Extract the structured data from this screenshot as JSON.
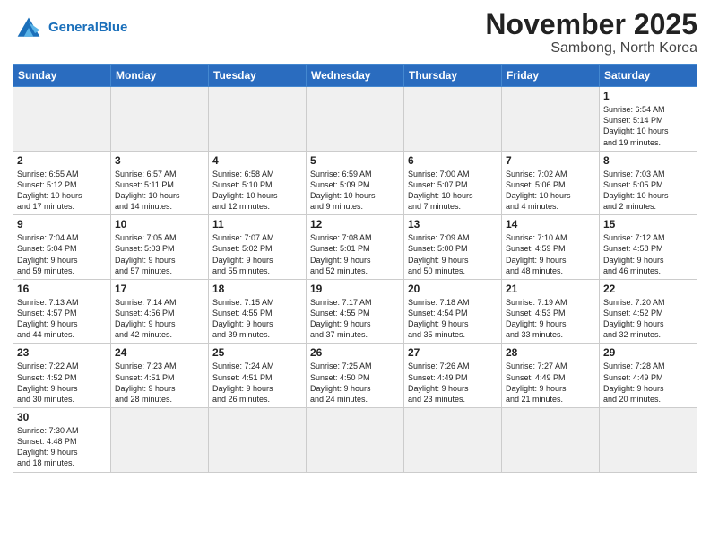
{
  "header": {
    "logo_general": "General",
    "logo_blue": "Blue",
    "title": "November 2025",
    "subtitle": "Sambong, North Korea"
  },
  "weekdays": [
    "Sunday",
    "Monday",
    "Tuesday",
    "Wednesday",
    "Thursday",
    "Friday",
    "Saturday"
  ],
  "days": [
    {
      "num": "",
      "info": "",
      "empty": true
    },
    {
      "num": "",
      "info": "",
      "empty": true
    },
    {
      "num": "",
      "info": "",
      "empty": true
    },
    {
      "num": "",
      "info": "",
      "empty": true
    },
    {
      "num": "",
      "info": "",
      "empty": true
    },
    {
      "num": "",
      "info": "",
      "empty": true
    },
    {
      "num": "1",
      "info": "Sunrise: 6:54 AM\nSunset: 5:14 PM\nDaylight: 10 hours\nand 19 minutes."
    },
    {
      "num": "2",
      "info": "Sunrise: 6:55 AM\nSunset: 5:12 PM\nDaylight: 10 hours\nand 17 minutes."
    },
    {
      "num": "3",
      "info": "Sunrise: 6:57 AM\nSunset: 5:11 PM\nDaylight: 10 hours\nand 14 minutes."
    },
    {
      "num": "4",
      "info": "Sunrise: 6:58 AM\nSunset: 5:10 PM\nDaylight: 10 hours\nand 12 minutes."
    },
    {
      "num": "5",
      "info": "Sunrise: 6:59 AM\nSunset: 5:09 PM\nDaylight: 10 hours\nand 9 minutes."
    },
    {
      "num": "6",
      "info": "Sunrise: 7:00 AM\nSunset: 5:07 PM\nDaylight: 10 hours\nand 7 minutes."
    },
    {
      "num": "7",
      "info": "Sunrise: 7:02 AM\nSunset: 5:06 PM\nDaylight: 10 hours\nand 4 minutes."
    },
    {
      "num": "8",
      "info": "Sunrise: 7:03 AM\nSunset: 5:05 PM\nDaylight: 10 hours\nand 2 minutes."
    },
    {
      "num": "9",
      "info": "Sunrise: 7:04 AM\nSunset: 5:04 PM\nDaylight: 9 hours\nand 59 minutes."
    },
    {
      "num": "10",
      "info": "Sunrise: 7:05 AM\nSunset: 5:03 PM\nDaylight: 9 hours\nand 57 minutes."
    },
    {
      "num": "11",
      "info": "Sunrise: 7:07 AM\nSunset: 5:02 PM\nDaylight: 9 hours\nand 55 minutes."
    },
    {
      "num": "12",
      "info": "Sunrise: 7:08 AM\nSunset: 5:01 PM\nDaylight: 9 hours\nand 52 minutes."
    },
    {
      "num": "13",
      "info": "Sunrise: 7:09 AM\nSunset: 5:00 PM\nDaylight: 9 hours\nand 50 minutes."
    },
    {
      "num": "14",
      "info": "Sunrise: 7:10 AM\nSunset: 4:59 PM\nDaylight: 9 hours\nand 48 minutes."
    },
    {
      "num": "15",
      "info": "Sunrise: 7:12 AM\nSunset: 4:58 PM\nDaylight: 9 hours\nand 46 minutes."
    },
    {
      "num": "16",
      "info": "Sunrise: 7:13 AM\nSunset: 4:57 PM\nDaylight: 9 hours\nand 44 minutes."
    },
    {
      "num": "17",
      "info": "Sunrise: 7:14 AM\nSunset: 4:56 PM\nDaylight: 9 hours\nand 42 minutes."
    },
    {
      "num": "18",
      "info": "Sunrise: 7:15 AM\nSunset: 4:55 PM\nDaylight: 9 hours\nand 39 minutes."
    },
    {
      "num": "19",
      "info": "Sunrise: 7:17 AM\nSunset: 4:55 PM\nDaylight: 9 hours\nand 37 minutes."
    },
    {
      "num": "20",
      "info": "Sunrise: 7:18 AM\nSunset: 4:54 PM\nDaylight: 9 hours\nand 35 minutes."
    },
    {
      "num": "21",
      "info": "Sunrise: 7:19 AM\nSunset: 4:53 PM\nDaylight: 9 hours\nand 33 minutes."
    },
    {
      "num": "22",
      "info": "Sunrise: 7:20 AM\nSunset: 4:52 PM\nDaylight: 9 hours\nand 32 minutes."
    },
    {
      "num": "23",
      "info": "Sunrise: 7:22 AM\nSunset: 4:52 PM\nDaylight: 9 hours\nand 30 minutes."
    },
    {
      "num": "24",
      "info": "Sunrise: 7:23 AM\nSunset: 4:51 PM\nDaylight: 9 hours\nand 28 minutes."
    },
    {
      "num": "25",
      "info": "Sunrise: 7:24 AM\nSunset: 4:51 PM\nDaylight: 9 hours\nand 26 minutes."
    },
    {
      "num": "26",
      "info": "Sunrise: 7:25 AM\nSunset: 4:50 PM\nDaylight: 9 hours\nand 24 minutes."
    },
    {
      "num": "27",
      "info": "Sunrise: 7:26 AM\nSunset: 4:49 PM\nDaylight: 9 hours\nand 23 minutes."
    },
    {
      "num": "28",
      "info": "Sunrise: 7:27 AM\nSunset: 4:49 PM\nDaylight: 9 hours\nand 21 minutes."
    },
    {
      "num": "29",
      "info": "Sunrise: 7:28 AM\nSunset: 4:49 PM\nDaylight: 9 hours\nand 20 minutes."
    },
    {
      "num": "30",
      "info": "Sunrise: 7:30 AM\nSunset: 4:48 PM\nDaylight: 9 hours\nand 18 minutes."
    },
    {
      "num": "",
      "info": "",
      "empty": true
    },
    {
      "num": "",
      "info": "",
      "empty": true
    },
    {
      "num": "",
      "info": "",
      "empty": true
    },
    {
      "num": "",
      "info": "",
      "empty": true
    },
    {
      "num": "",
      "info": "",
      "empty": true
    },
    {
      "num": "",
      "info": "",
      "empty": true
    }
  ]
}
